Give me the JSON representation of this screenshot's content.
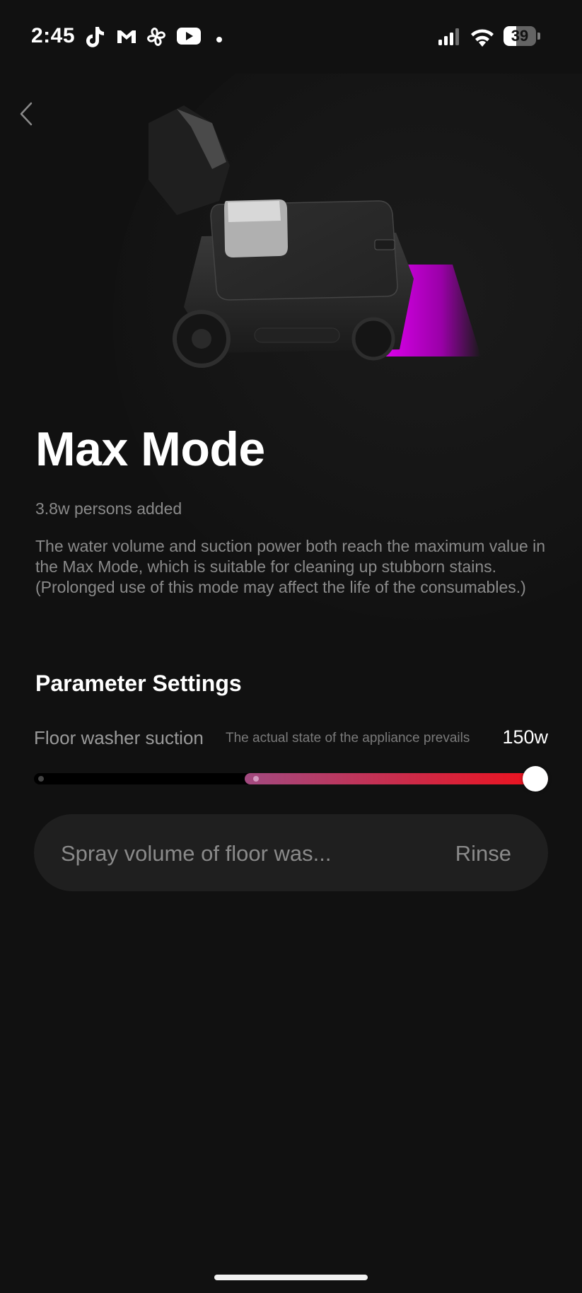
{
  "status_bar": {
    "time": "2:45",
    "battery_level": 39,
    "battery_text": "39",
    "icons": [
      "tiktok-icon",
      "gmail-icon",
      "pinwheel-icon",
      "youtube-icon",
      "dot-icon",
      "signal-icon",
      "wifi-icon",
      "battery-icon"
    ]
  },
  "header": {
    "back_icon": "chevron-left-icon"
  },
  "mode": {
    "title": "Max Mode",
    "subtitle": "3.8w persons added",
    "description": "The water volume and suction power both reach the maximum value in the Max Mode, which is suitable for cleaning up stubborn stains. (Prolonged use of this mode may affect the life of the consumables.)",
    "illustration": "floor-washer-illustration",
    "accent_color": "#e000f0"
  },
  "parameters": {
    "section_title": "Parameter Settings",
    "suction": {
      "label": "Floor washer suction",
      "hint": "The actual state of the appliance prevails",
      "value": "150w",
      "level_fraction": 1.0,
      "fill_start_fraction": 0.41,
      "gradient_colors": [
        "#a24a80",
        "#f0101a"
      ]
    },
    "spray": {
      "label": "Spray volume of floor was...",
      "value": "Rinse"
    }
  },
  "colors": {
    "background": "#111111",
    "card": "#1f1f1f",
    "muted_text": "#8a8a8a"
  }
}
